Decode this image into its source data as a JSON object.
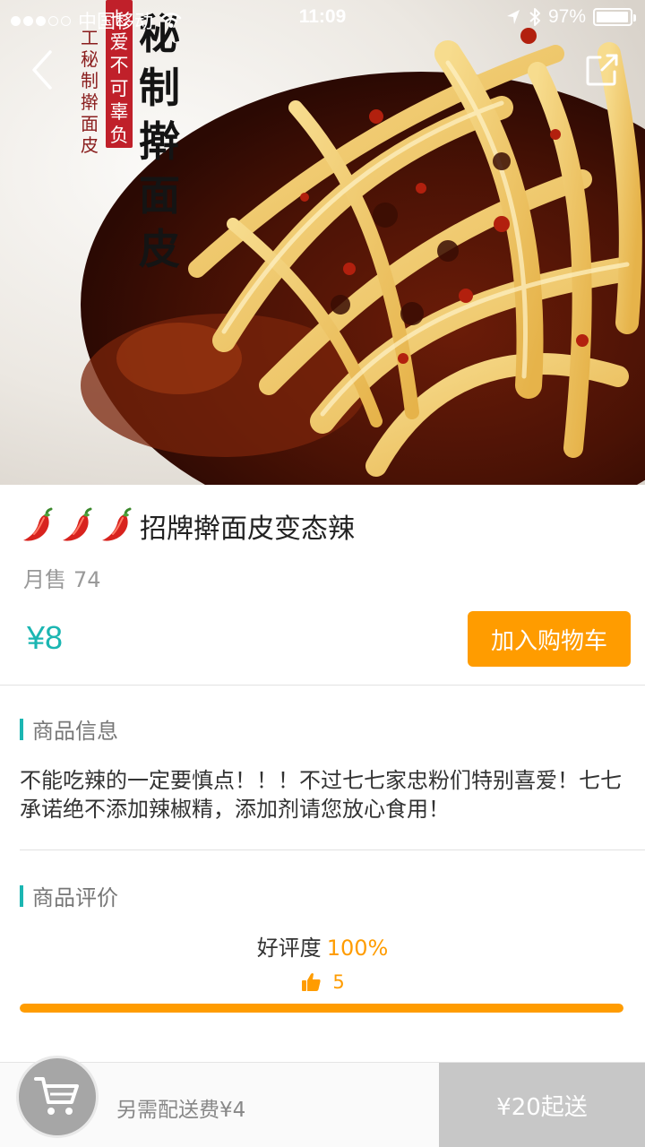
{
  "status_bar": {
    "carrier": "中国移动",
    "time": "11:09",
    "battery_percent": "97%",
    "battery_level": 0.97
  },
  "hero": {
    "brand_small_text": "工秘制擀面皮",
    "brand_seal_text": "七爱不可辜负",
    "brand_big_text": "秘制擀面皮",
    "icons": [
      "back-arrow-icon",
      "share-icon"
    ]
  },
  "product": {
    "chili_count": 3,
    "name": "招牌擀面皮变态辣",
    "monthly_sales_label": "月售",
    "monthly_sales": "74",
    "price": "¥8",
    "add_to_cart_label": "加入购物车"
  },
  "info_section": {
    "heading": "商品信息",
    "description": "不能吃辣的一定要慎点！！！不过七七家忠粉们特别喜爱！七七承诺绝不添加辣椒精，添加剂请您放心食用！"
  },
  "review_section": {
    "heading": "商品评价",
    "rating_label": "好评度",
    "rating_value": "100%",
    "like_count": "5",
    "rating_fraction": 1.0
  },
  "bottom_bar": {
    "delivery_fee_text": "另需配送费¥4",
    "min_order_text": "¥20起送",
    "cart_icon": "cart-icon"
  },
  "colors": {
    "accent_teal": "#1bb6b2",
    "accent_orange": "#ff9c00",
    "disabled_gray": "#c7c7c7"
  }
}
